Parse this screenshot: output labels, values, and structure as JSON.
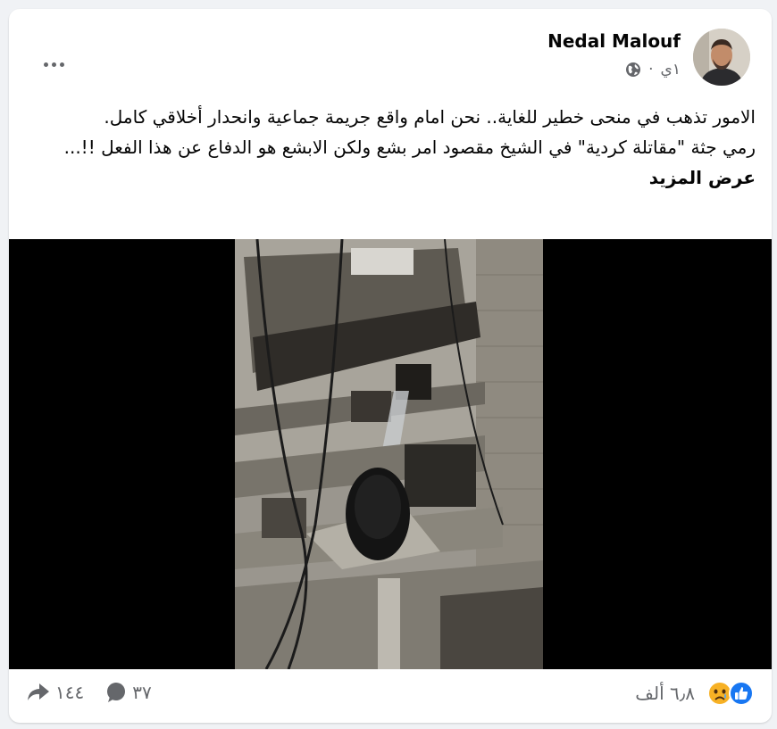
{
  "post": {
    "author": "Nedal Malouf",
    "time": "١ي",
    "time_separator": "·",
    "text_line_1": "الامور تذهب في منحى خطير للغاية.. نحن امام واقع جريمة جماعية وانحدار أخلاقي كامل.",
    "text_line_2": "رمي جثة \"مقاتلة كردية\" في الشيخ مقصود امر بشع ولكن الابشع هو الدفاع عن هذا الفعل !!...",
    "see_more": "عرض المزيد"
  },
  "engagement": {
    "reactions_count": "٦٫٨ ألف",
    "comments_count": "٣٧",
    "shares_count": "١٤٤",
    "reaction_icons": [
      "like-icon",
      "sad-icon"
    ]
  },
  "colors": {
    "background": "#f0f2f5",
    "like_blue": "#1877f2",
    "sad_yellow": "#f7b125",
    "secondary_text": "#65676b"
  }
}
